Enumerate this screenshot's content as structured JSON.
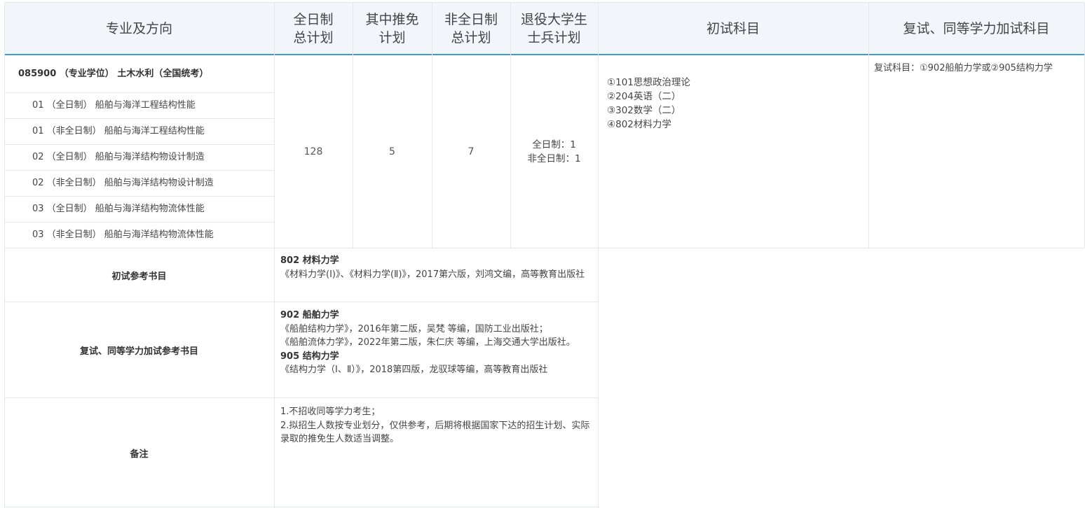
{
  "header": {
    "major": "专业及方向",
    "fulltime_plan": [
      "全日制",
      "总计划"
    ],
    "exempt_plan": [
      "其中推免",
      "计划"
    ],
    "parttime_plan": [
      "非全日制",
      "总计划"
    ],
    "soldier_plan": [
      "退役大学生",
      "士兵计划"
    ],
    "initial_subjects": "初试科目",
    "retest_subjects": "复试、同等学力加试科目"
  },
  "major": {
    "title": "085900 （专业学位） 土木水利（全国统考）",
    "directions": [
      "01 （全日制） 船舶与海洋工程结构性能",
      "01 （非全日制） 船舶与海洋工程结构性能",
      "02 （全日制） 船舶与海洋结构物设计制造",
      "02 （非全日制） 船舶与海洋结构物设计制造",
      "03 （全日制） 船舶与海洋结构物流体性能",
      "03 （非全日制） 船舶与海洋结构物流体性能"
    ],
    "fulltime_total": "128",
    "exempt": "5",
    "parttime_total": "7",
    "soldier": [
      "全日制：1",
      "非全日制：1"
    ],
    "initial_subjects": [
      "①101思想政治理论",
      "②204英语（二）",
      "③302数学（二）",
      "④802材料力学"
    ],
    "retest": "复试科目：①902船舶力学或②905结构力学"
  },
  "books": {
    "initial_label": "初试参考书目",
    "initial_title": "802 材料力学",
    "initial_text": "《材料力学(Ⅰ)》、《材料力学(Ⅱ)》，2017第六版，刘鸿文编，高等教育出版社",
    "retest_label": "复试、同等学力加试参考书目",
    "retest_title1": "902 船舶力学",
    "retest_text1a": "《船舶结构力学》，2016年第二版，吴梵 等编，国防工业出版社；",
    "retest_text1b": "《船舶流体力学》，2022年第二版，朱仁庆 等编，上海交通大学出版社。",
    "retest_title2": "905 结构力学",
    "retest_text2": "《结构力学（Ⅰ、Ⅱ）》，2018第四版，龙驭球等编，高等教育出版社"
  },
  "notes": {
    "label": "备注",
    "lines": [
      "1.不招收同等学力考生；",
      "2.拟招生人数按专业划分，仅供参考，后期将根据国家下达的招生计划、实际录取的推免生人数适当调整。"
    ]
  },
  "colors": {
    "header_bg": "#f2f6fb",
    "accent_line": "#3b9ddd",
    "grid_line": "#e4e7eb"
  }
}
